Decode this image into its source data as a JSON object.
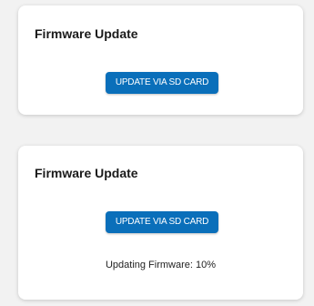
{
  "cards": [
    {
      "title": "Firmware Update",
      "button_label": "UPDATE VIA SD CARD"
    },
    {
      "title": "Firmware Update",
      "button_label": "UPDATE VIA SD CARD",
      "status": "Updating Firmware: 10%"
    }
  ],
  "colors": {
    "button_bg": "#0a6fba",
    "card_bg": "#ffffff",
    "page_bg": "#f2f2f2"
  }
}
